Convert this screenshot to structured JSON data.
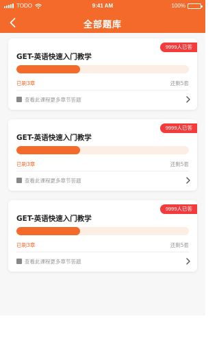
{
  "status_bar": {
    "carrier": "TODO",
    "time": "9:41 AM",
    "battery": "100%"
  },
  "nav": {
    "title": "全部题库"
  },
  "cards": [
    {
      "badge": "9999人已答",
      "title": "GET-英语快速入门教学",
      "progress": 0.37,
      "done_label": "已刷3章",
      "remain_label": "还剩5套",
      "more_label": "查看此课程更多章节答题"
    },
    {
      "badge": "9999人已答",
      "title": "GET-英语快速入门教学",
      "progress": 0.37,
      "done_label": "已刷3章",
      "remain_label": "还剩5套",
      "more_label": "查看此课程更多章节答题"
    },
    {
      "badge": "9999人已答",
      "title": "GET-英语快速入门教学",
      "progress": 0.37,
      "done_label": "已刷3章",
      "remain_label": "还剩5套",
      "more_label": "查看此课程更多章节答题"
    }
  ],
  "colors": {
    "brand": "#f36a2b",
    "badge": "#f33b3b",
    "track": "#fdeee3"
  },
  "icons": {
    "back": "chevron-left-icon",
    "more": "chevron-right-icon",
    "doc": "doc-icon",
    "wifi": "wifi-icon",
    "signal": "signal-icon",
    "battery": "battery-icon"
  }
}
